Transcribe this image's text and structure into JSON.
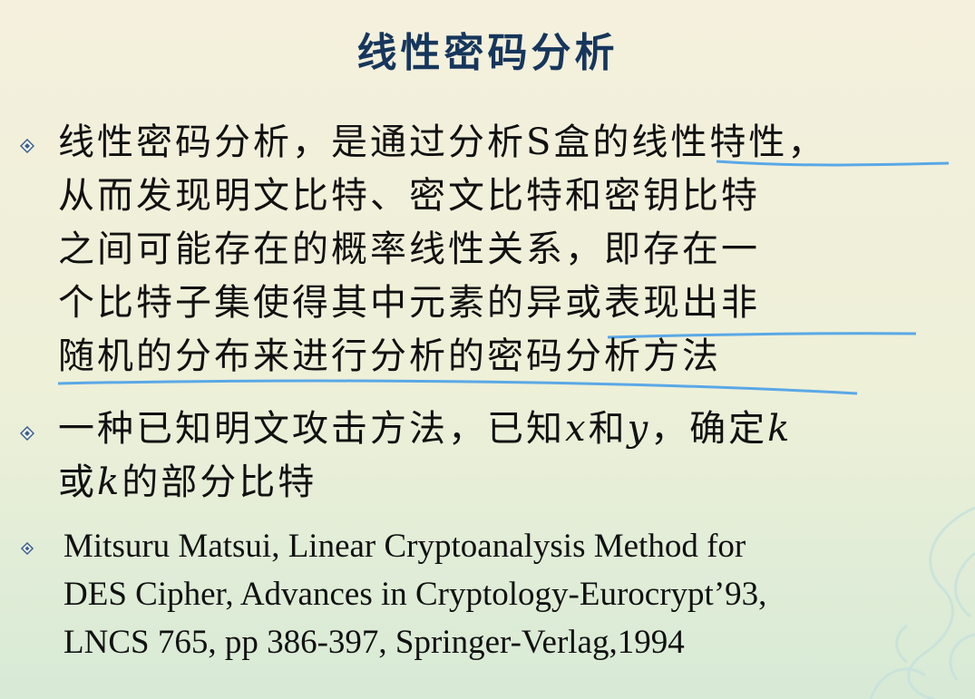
{
  "title": "线性密码分析",
  "bullets": [
    {
      "lines": [
        "线性密码分析，是通过分析S盒的线性特性，",
        "从而发现明文比特、密文比特和密钥比特",
        "之间可能存在的概率线性关系，即存在一",
        "个比特子集使得其中元素的异或表现出非",
        "随机的分布来进行分析的密码分析方法"
      ]
    },
    {
      "line1_a": "一种已知明文攻击方法，已知",
      "x": "x",
      "line1_b": "和",
      "y": "y",
      "line1_c": "，确定",
      "k1": "k",
      "line2_a": "或",
      "k2": "k",
      "line2_b": "的部分比特"
    },
    {
      "lines": [
        "Mitsuru Matsui, Linear Cryptoanalysis Method for",
        "DES Cipher, Advances in Cryptology-Eurocrypt’93,",
        "LNCS 765, pp 386-397, Springer-Verlag,1994"
      ]
    }
  ],
  "colors": {
    "title": "#16365c",
    "underline": "#5aa8e6",
    "bullet": "#3a5f8a"
  }
}
